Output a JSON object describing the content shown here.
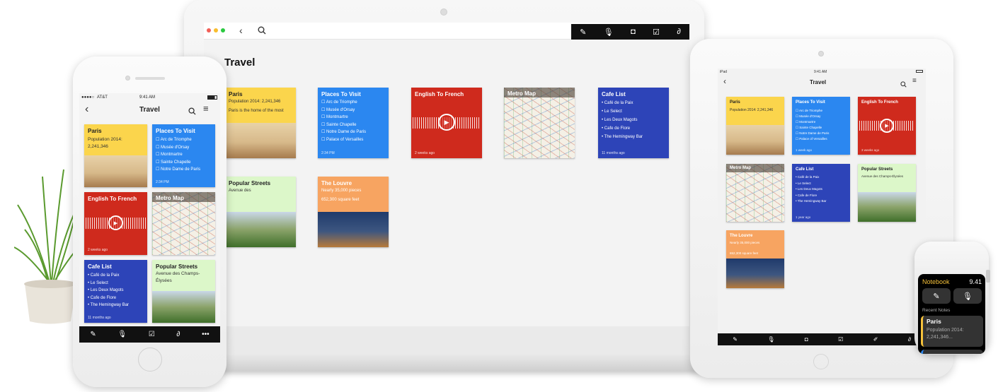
{
  "notebook_title": "Travel",
  "laptop": {
    "cards": {
      "paris": {
        "title": "Paris",
        "line1": "Population 2014: 2,241,346",
        "line2": "Paris is the home of the most"
      },
      "places": {
        "title": "Places To Visit",
        "items": [
          "Arc de Triomphe",
          "Musée d'Orsay",
          "Montmartre",
          "Sainte Chapelle",
          "Notre Dame de Paris",
          "Palace of Versailles"
        ],
        "footer": "2:34 PM"
      },
      "english": {
        "title": "English To French",
        "footer": "2 weeks ago"
      },
      "metro": {
        "title": "Metro Map"
      },
      "cafe": {
        "title": "Cafe List",
        "items": [
          "Café de la Paix",
          "Le Select",
          "Les Deux Magots",
          "Cafe de Flore",
          "The Hemingway Bar"
        ],
        "footer": "11 months ago"
      },
      "streets": {
        "title": "Popular Streets",
        "line1": "Avenue des"
      },
      "louvre": {
        "title": "The Louvre",
        "line1": "Nearly 35,000 pieces",
        "line2": "652,300 square feet"
      }
    }
  },
  "iphone": {
    "status": {
      "carrier": "AT&T",
      "time": "9:41 AM"
    },
    "cards": {
      "paris": {
        "title": "Paris",
        "line1": "Population 2014:",
        "line2": "2,241,346"
      },
      "places": {
        "title": "Places To Visit",
        "items": [
          "Arc de Triomphe",
          "Musée d'Orsay",
          "Montmartre",
          "Sainte Chapelle",
          "Notre Dame de Paris"
        ],
        "footer": "2:34 PM"
      },
      "english": {
        "title": "English To French",
        "footer": "2 weeks ago"
      },
      "metro": {
        "title": "Metro Map"
      },
      "cafe": {
        "title": "Cafe List",
        "items": [
          "Café de la Paix",
          "Le Select",
          "Les Deux Magots",
          "Cafe de Flore",
          "The Hemingway Bar"
        ],
        "footer": "11 months ago"
      },
      "streets": {
        "title": "Popular Streets",
        "line1": "Avenue des Champs-",
        "line2": "Élysées"
      }
    }
  },
  "ipad": {
    "status": {
      "device": "iPad",
      "time": "9:41 AM"
    },
    "cards": {
      "paris": {
        "title": "Paris",
        "line1": "Population 2014: 2,241,346"
      },
      "places": {
        "title": "Places To Visit",
        "items": [
          "Arc de Triomphe",
          "Musée d'Orsay",
          "Montmartre",
          "Sainte Chapelle",
          "Notre Dame de Paris",
          "Palace of Versailles"
        ],
        "footer": "1 week ago"
      },
      "english": {
        "title": "English To French",
        "footer": "3 weeks ago"
      },
      "metro": {
        "title": "Metro Map"
      },
      "cafe": {
        "title": "Cafe List",
        "items": [
          "Café de la Paix",
          "Le Select",
          "Les Deux Magots",
          "Cafe de Flore",
          "The Hemingway Bar"
        ],
        "footer": "1 year ago"
      },
      "streets": {
        "title": "Popular Streets",
        "line1": "Avenue des Champs-Élysées"
      },
      "louvre": {
        "title": "The Louvre",
        "line1": "Nearly 35,000 pieces",
        "line2": "652,300 square feet"
      }
    }
  },
  "watch": {
    "app_title": "Notebook",
    "time": "9.41",
    "section_label": "Recent Notes",
    "note": {
      "title": "Paris",
      "line1": "Population 2014:",
      "line2": "2,241,346..."
    }
  },
  "icons": [
    "compose-icon",
    "microphone-icon",
    "camera-icon",
    "checklist-icon",
    "paperclip-icon",
    "search-icon",
    "menu-icon",
    "back-icon",
    "more-icon",
    "sketch-icon",
    "play-icon"
  ],
  "colors": {
    "paris": "#fbd54c",
    "places": "#2b87f0",
    "english": "#cf2a1d",
    "cafe": "#2d44b8",
    "streets": "#dcf7c9",
    "louvre": "#f7a461",
    "toolbar": "#111111"
  }
}
